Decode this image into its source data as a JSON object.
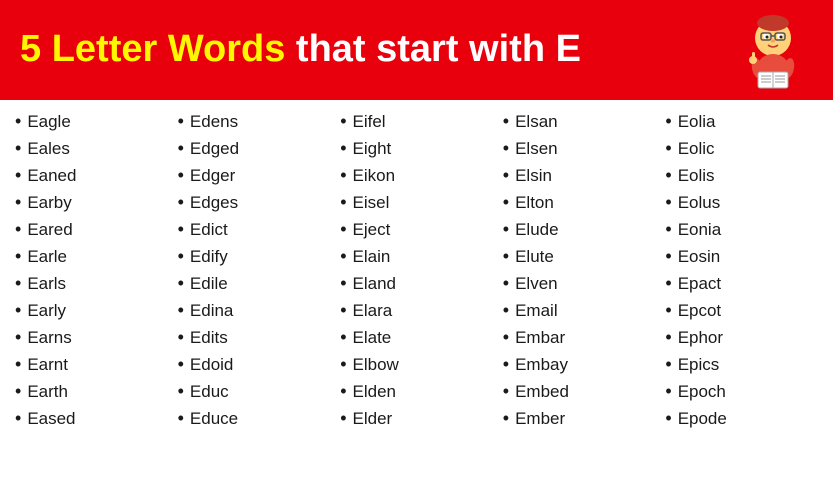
{
  "header": {
    "title_bold": "5 Letter Words",
    "title_regular": " that start with E"
  },
  "columns": [
    {
      "id": "col1",
      "words": [
        "Eagle",
        "Eales",
        "Eaned",
        "Earby",
        "Eared",
        "Earle",
        "Earls",
        "Early",
        "Earns",
        "Earnt",
        "Earth",
        "Eased"
      ]
    },
    {
      "id": "col2",
      "words": [
        "Edens",
        "Edged",
        "Edger",
        "Edges",
        "Edict",
        "Edify",
        "Edile",
        "Edina",
        "Edits",
        "Edoid",
        "Educ",
        "Educe"
      ]
    },
    {
      "id": "col3",
      "words": [
        "Eifel",
        "Eight",
        "Eikon",
        "Eisel",
        "Eject",
        "Elain",
        "Eland",
        "Elara",
        "Elate",
        "Elbow",
        "Elden",
        "Elder"
      ]
    },
    {
      "id": "col4",
      "words": [
        "Elsan",
        "Elsen",
        "Elsin",
        "Elton",
        "Elude",
        "Elute",
        "Elven",
        "Email",
        "Embar",
        "Embay",
        "Embed",
        "Ember"
      ]
    },
    {
      "id": "col5",
      "words": [
        "Eolia",
        "Eolic",
        "Eolis",
        "Eolus",
        "Eonia",
        "Eosin",
        "Epact",
        "Epcot",
        "Ephor",
        "Epics",
        "Epoch",
        "Epode"
      ]
    }
  ]
}
